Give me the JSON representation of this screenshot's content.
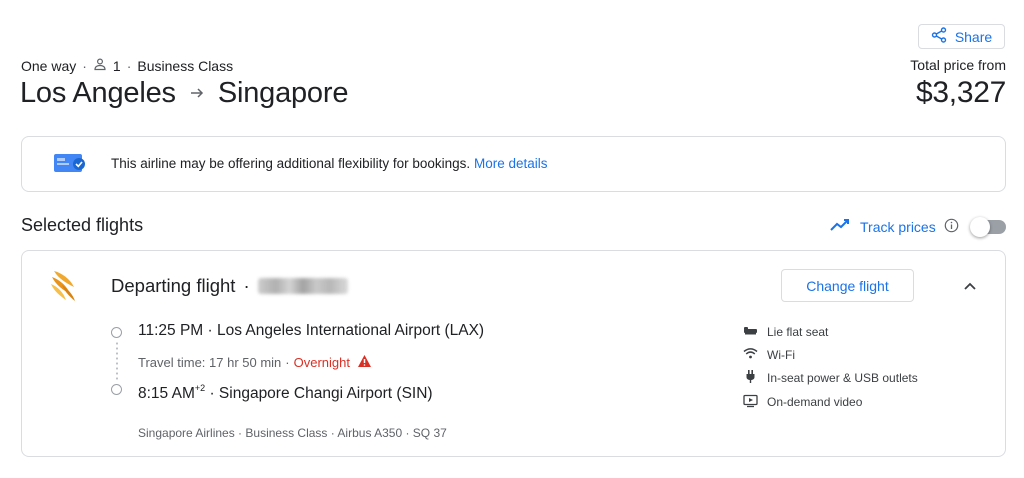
{
  "header": {
    "share_label": "Share",
    "trip_type": "One way",
    "passengers": "1",
    "cabin": "Business Class",
    "origin": "Los Angeles",
    "destination": "Singapore",
    "price_label": "Total price from",
    "price": "$3,327"
  },
  "notice": {
    "message": "This airline may be offering additional flexibility for bookings.",
    "link": "More details"
  },
  "selected": {
    "title": "Selected flights",
    "track_label": "Track prices",
    "track_enabled": false
  },
  "flight": {
    "title": "Departing flight",
    "change_label": "Change flight",
    "departure_time": "11:25 PM",
    "departure_airport": "Los Angeles International Airport (LAX)",
    "travel_time": "Travel time: 17 hr 50 min",
    "overnight": "Overnight",
    "arrival_time": "8:15 AM",
    "arrival_offset": "+2",
    "arrival_airport": "Singapore Changi Airport (SIN)",
    "details": "Singapore Airlines · Business Class · Airbus A350 · SQ 37",
    "amenities": [
      {
        "icon": "lie-flat-seat-icon",
        "label": "Lie flat seat"
      },
      {
        "icon": "wifi-icon",
        "label": "Wi-Fi"
      },
      {
        "icon": "power-plug-icon",
        "label": "In-seat power & USB outlets"
      },
      {
        "icon": "video-icon",
        "label": "On-demand video"
      }
    ]
  },
  "colors": {
    "accent": "#1a73e8",
    "warning": "#d93025",
    "text": "#202124",
    "muted": "#5f6368",
    "border": "#dadce0",
    "airline_logo": "#f0a92e"
  }
}
